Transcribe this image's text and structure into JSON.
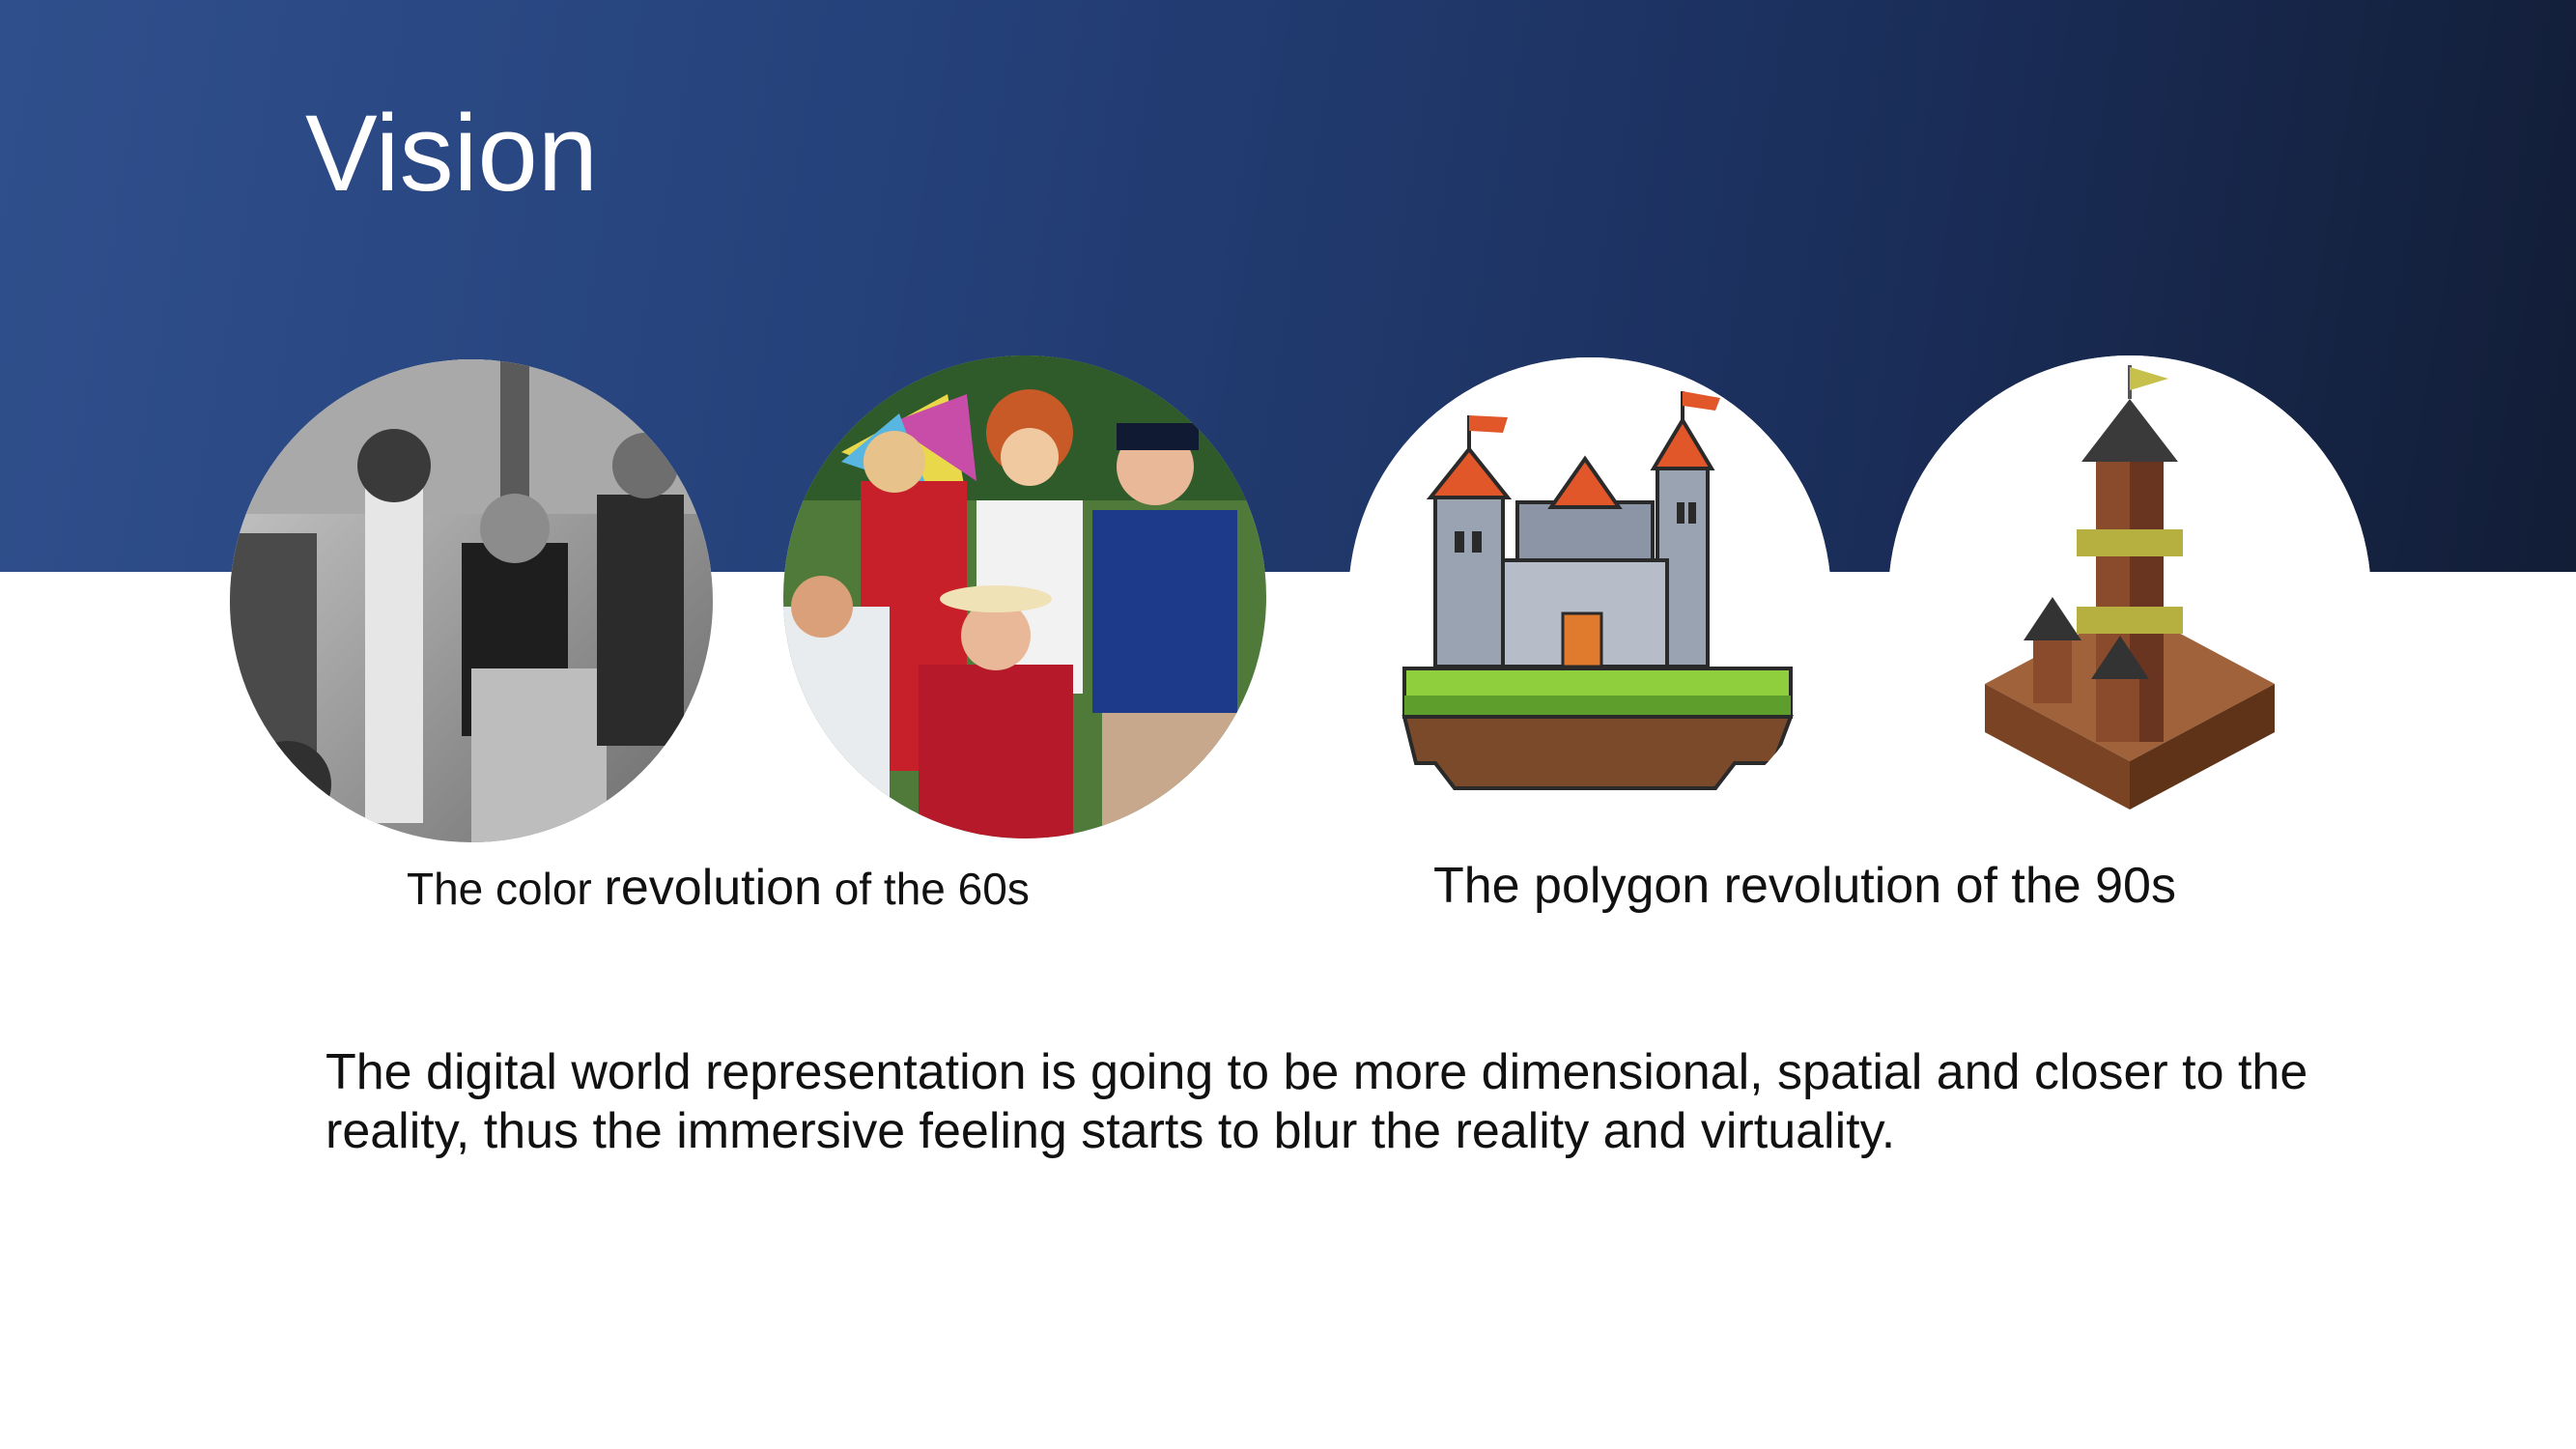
{
  "slide": {
    "title": "Vision"
  },
  "images": [
    {
      "name": "black-and-white-cast-photo"
    },
    {
      "name": "color-cast-photo"
    },
    {
      "name": "pixel-castle-illustration"
    },
    {
      "name": "polygon-castle-illustration"
    }
  ],
  "captions": {
    "left_a": "The color ",
    "left_b": "revolution",
    "left_c": " of the 60s",
    "right": "The polygon revolution of the 90s"
  },
  "body": {
    "line1": "The digital world representation is going to be more dimensional, spatial and closer to the",
    "line2": "reality, thus the immersive feeling starts to blur the reality and virtuality."
  },
  "colors": {
    "header_dark": "#121d36",
    "header_light": "#2f4f8c",
    "text": "#111111"
  }
}
